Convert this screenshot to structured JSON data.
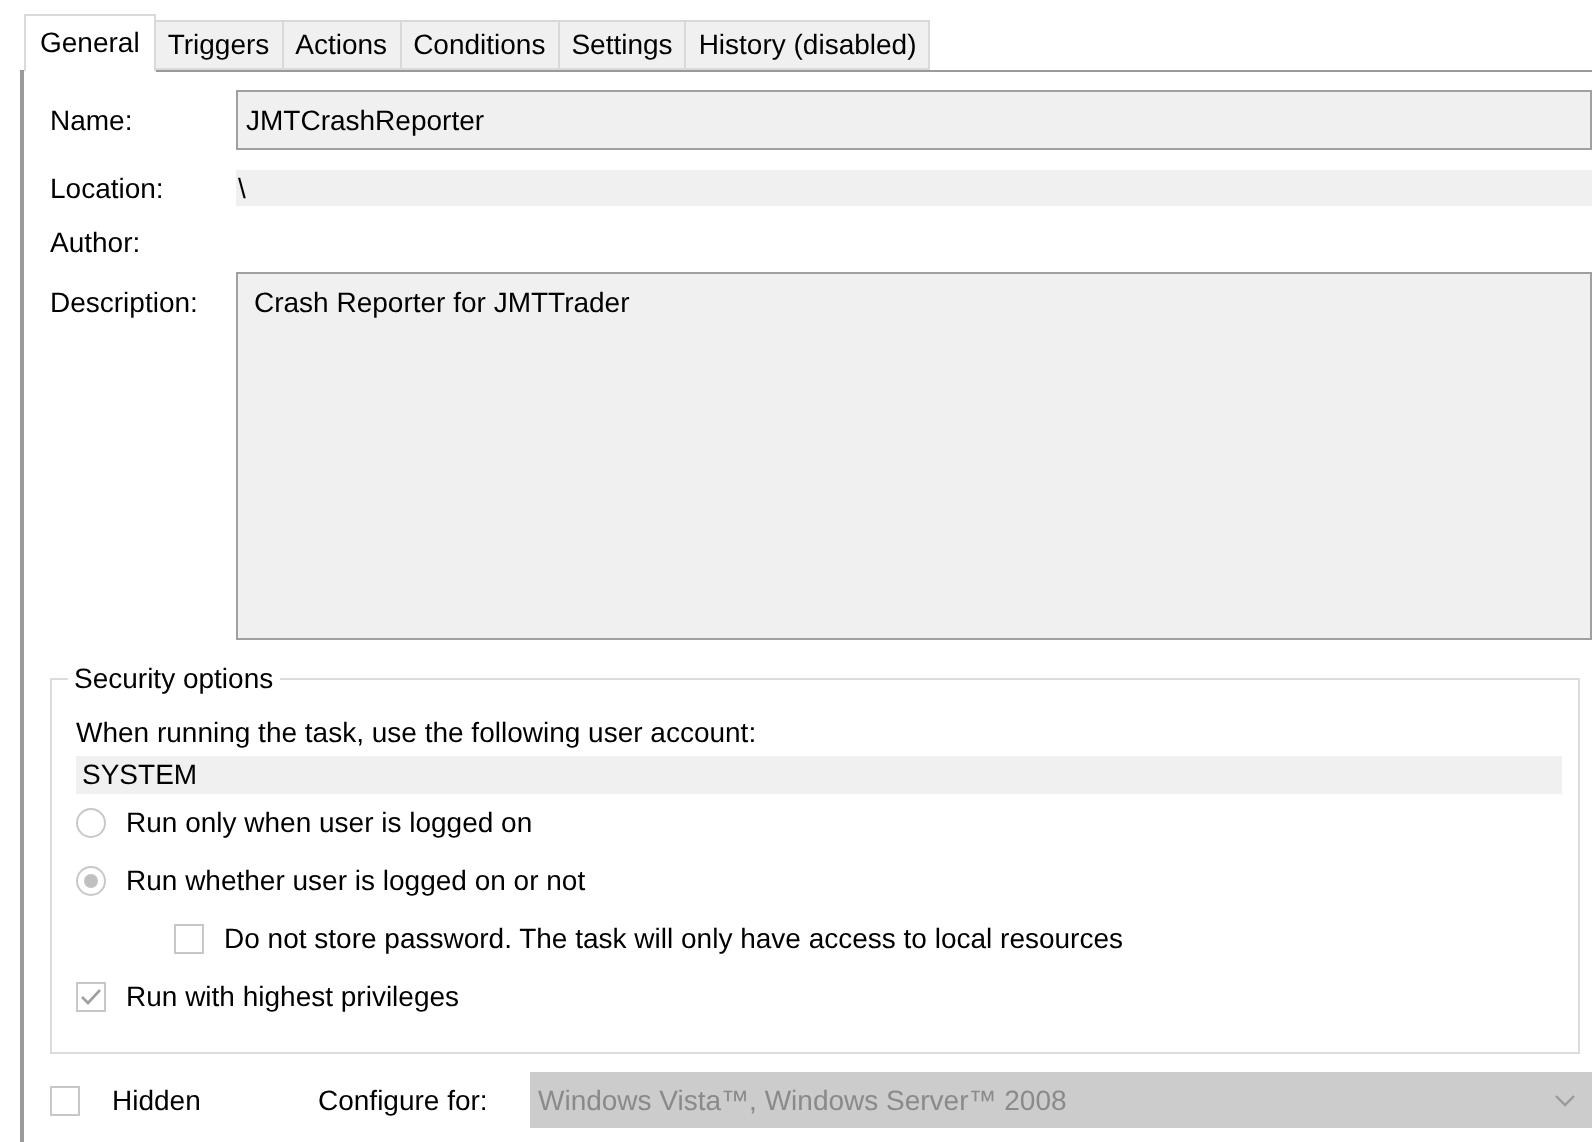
{
  "tabs": [
    {
      "label": "General",
      "selected": true
    },
    {
      "label": "Triggers",
      "selected": false
    },
    {
      "label": "Actions",
      "selected": false
    },
    {
      "label": "Conditions",
      "selected": false
    },
    {
      "label": "Settings",
      "selected": false
    },
    {
      "label": "History (disabled)",
      "selected": false
    }
  ],
  "name": {
    "label": "Name:",
    "value": "JMTCrashReporter"
  },
  "location": {
    "label": "Location:",
    "value": "\\"
  },
  "author": {
    "label": "Author:"
  },
  "description": {
    "label": "Description:",
    "value": "Crash Reporter for JMTTrader"
  },
  "security_options": {
    "title": "Security options",
    "account_label": "When running the task, use the following user account:",
    "account": "SYSTEM",
    "options": [
      {
        "kind": "radio",
        "label": "Run only when user is logged on",
        "selected": false
      },
      {
        "kind": "radio",
        "label": "Run whether user is logged on or not",
        "selected": true,
        "children": [
          {
            "kind": "checkbox",
            "label": "Do not store password.  The task will only have access to local resources",
            "checked": false
          }
        ]
      },
      {
        "kind": "checkbox",
        "label": "Run with highest privileges",
        "checked": true
      }
    ]
  },
  "hidden": {
    "label": "Hidden",
    "checked": false
  },
  "configure_for": {
    "label": "Configure for:",
    "value": "Windows Vista™, Windows Server™ 2008"
  }
}
